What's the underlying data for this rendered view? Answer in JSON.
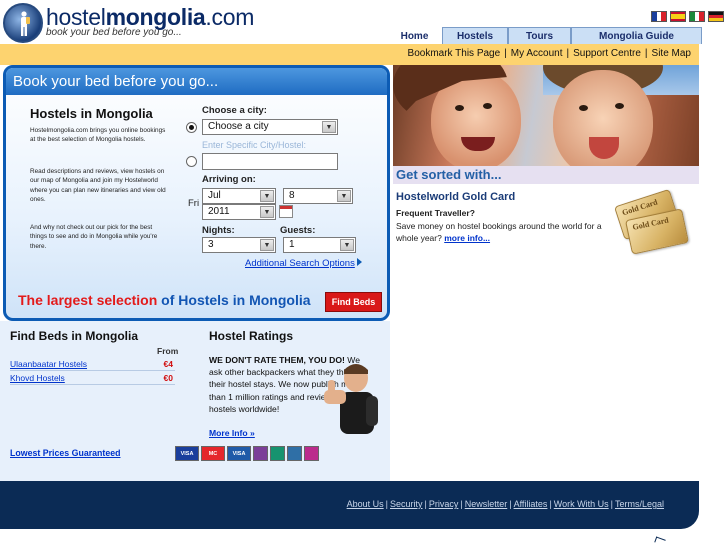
{
  "brand": {
    "name_plain": "hostel",
    "name_bold": "mongolia",
    "name_suffix": ".com",
    "tagline": "book your bed before you go..."
  },
  "language_flags": [
    {
      "name": "french-flag",
      "colors": [
        "#1a3e9c",
        "#ffffff",
        "#d8212b"
      ]
    },
    {
      "name": "spanish-flag",
      "colors": [
        "#c8102e",
        "#f7d117",
        "#c8102e"
      ]
    },
    {
      "name": "italian-flag",
      "colors": [
        "#1c8a3c",
        "#ffffff",
        "#d8212b"
      ]
    },
    {
      "name": "german-flag",
      "colors": [
        "#111111",
        "#d8212b",
        "#f5c518"
      ]
    }
  ],
  "nav_tabs": [
    "Home",
    "Hostels",
    "Tours",
    "Mongolia Guide"
  ],
  "utility_links": [
    "Bookmark This Page",
    "My Account",
    "Support Centre",
    "Site Map"
  ],
  "search": {
    "title": "Book your bed before you go...",
    "intro_heading": "Hostels in Mongolia",
    "intro_p1": "Hostelmongolia.com brings you online bookings at the best selection of Mongolia hostels.",
    "intro_p2": "Read descriptions and reviews, view hostels on our map of Mongolia and join my Hostelworld where you can plan new itineraries and view old ones.",
    "intro_p3": "And why not check out our pick for the best things to see and do in Mongolia while you're there.",
    "choose_city_label": "Choose a city:",
    "choose_city_value": "Choose a city",
    "specific_city_placeholder": "Enter Specific City/Hostel:",
    "specific_city_value": "",
    "arriving_label": "Arriving on:",
    "weekday": "Fri",
    "month_value": "Jul",
    "day_value": "8",
    "year_value": "2011",
    "nights_label": "Nights:",
    "nights_value": "3",
    "guests_label": "Guests:",
    "guests_value": "1",
    "advanced_link": "Additional Search Options",
    "promo_red": "The largest selection",
    "promo_blue": "of Hostels in Mongolia",
    "find_beds_button": "Find Beds"
  },
  "right_col": {
    "banner": "Get sorted with...",
    "gold_title": "Hostelworld Gold Card",
    "frequent": "Frequent Traveller?",
    "gold_desc": "Save money on hostel bookings around the world for a whole year?",
    "more_info": "more info...",
    "card_label": "Gold Card"
  },
  "find_beds": {
    "title": "Find Beds in Mongolia",
    "from_label": "From",
    "rows": [
      {
        "city": "Ulaanbaatar Hostels",
        "price": "€4"
      },
      {
        "city": "Khovd Hostels",
        "price": "€0"
      }
    ]
  },
  "ratings": {
    "title": "Hostel Ratings",
    "lead": "WE DON'T RATE THEM, YOU DO!",
    "body": "We ask other backpackers what they think of their hostel stays. We now publish more than 1 million ratings and reviews of hostels worldwide!",
    "more": "More Info »"
  },
  "lowest_prices": "Lowest Prices Guaranteed",
  "payment_cards": [
    {
      "name": "visa-card",
      "label": "VISA",
      "color": "#1a3e9c"
    },
    {
      "name": "mastercard-card",
      "label": "MC",
      "color": "#e5262b"
    },
    {
      "name": "visa-electron-card",
      "label": "VISA",
      "color": "#1f5aa8"
    },
    {
      "name": "switch-card",
      "label": "",
      "color": "#7b3f98"
    },
    {
      "name": "solo-card",
      "label": "",
      "color": "#16936f"
    },
    {
      "name": "laser-card",
      "label": "",
      "color": "#2f6fa6"
    },
    {
      "name": "diners-card",
      "label": "",
      "color": "#bb2b8c"
    }
  ],
  "footer_links": [
    "About Us",
    "Security",
    "Privacy",
    "Newsletter",
    "Affiliates",
    "Work With Us",
    "Terms/Legal"
  ]
}
